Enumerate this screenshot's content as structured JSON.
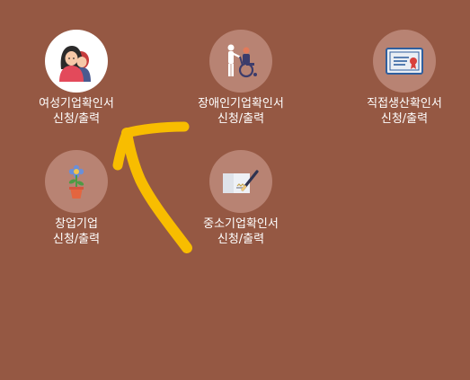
{
  "colors": {
    "background": "#955843",
    "icon_circle": "#b88373",
    "icon_circle_active": "#ffffff",
    "text": "#ffffff",
    "annotation_arrow": "#f8bd00"
  },
  "tiles": [
    {
      "id": "women",
      "icon": "women-icon",
      "title": "여성기업확인서",
      "subtitle": "신청/출력"
    },
    {
      "id": "disabled",
      "icon": "wheelchair-icon",
      "title": "장애인기업확인서",
      "subtitle": "신청/출력"
    },
    {
      "id": "direct",
      "icon": "certificate-icon",
      "title": "직접생산확인서",
      "subtitle": "신청/출력"
    },
    {
      "id": "startup",
      "icon": "flower-pot-icon",
      "title": "창업기업",
      "subtitle": "신청/출력"
    },
    {
      "id": "sme",
      "icon": "document-pen-icon",
      "title": "중소기업확인서",
      "subtitle": "신청/출력"
    }
  ]
}
